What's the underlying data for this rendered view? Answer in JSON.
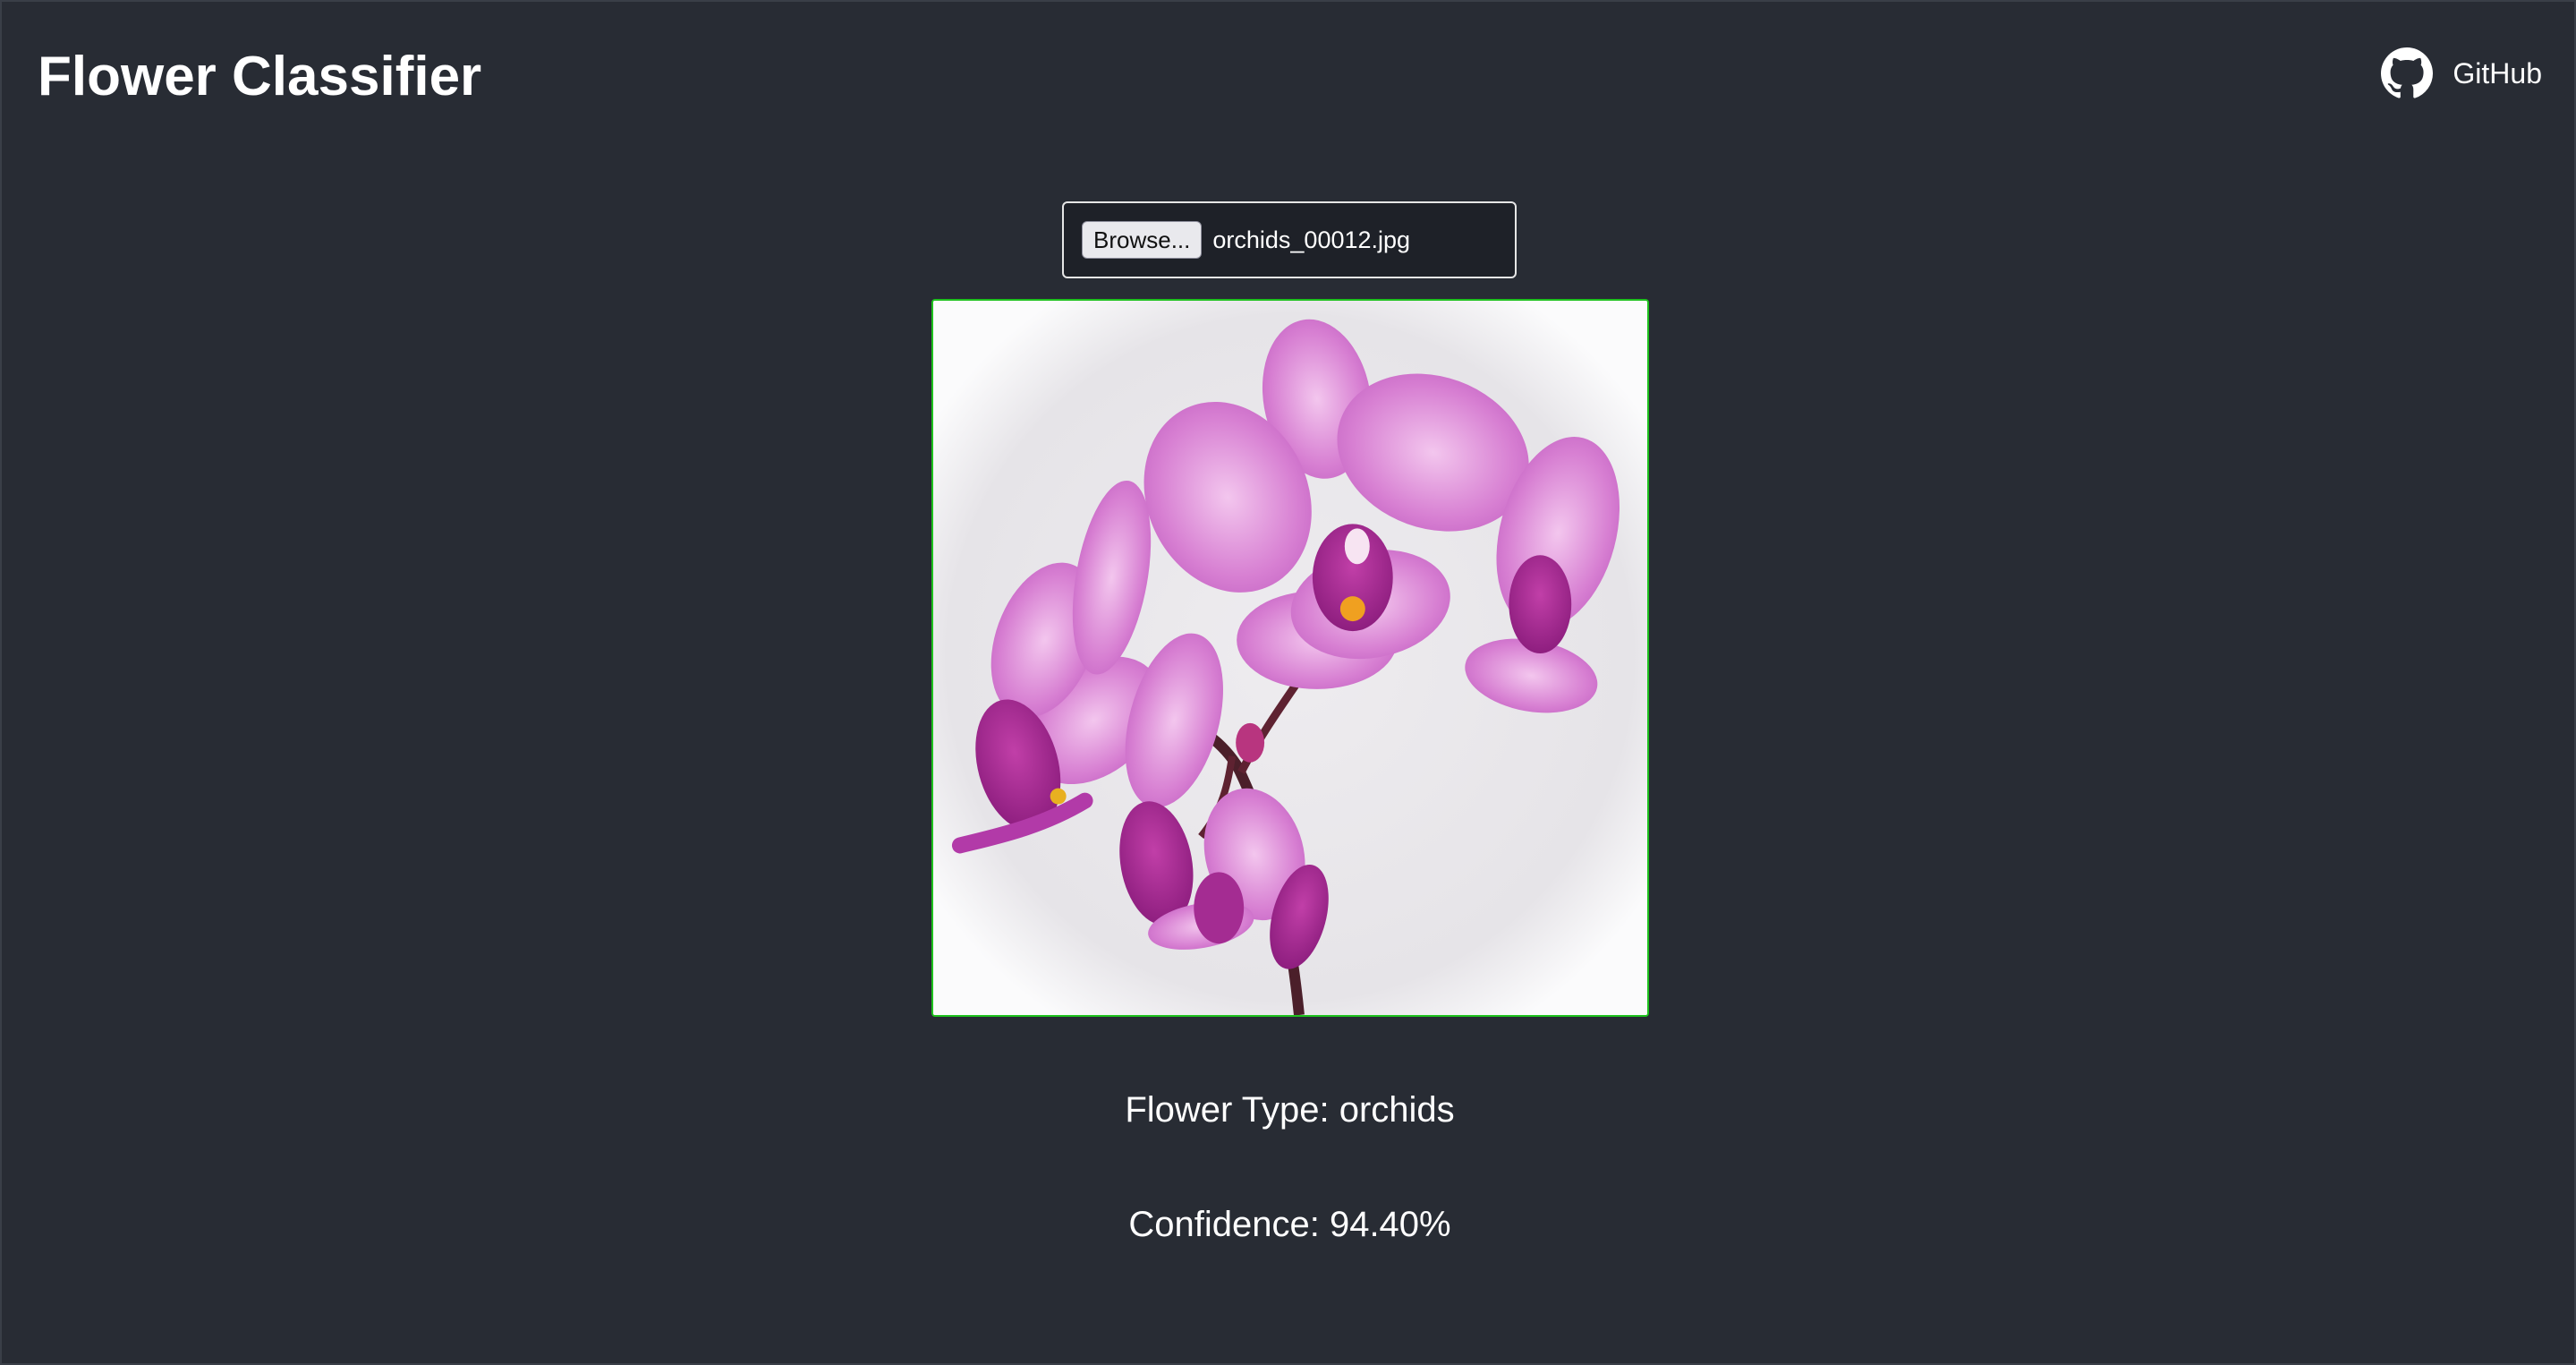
{
  "header": {
    "title": "Flower Classifier",
    "github_label": "GitHub",
    "github_icon": "github-icon"
  },
  "upload": {
    "browse_label": "Browse...",
    "file_name": "orchids_00012.jpg"
  },
  "preview": {
    "image_subject": "pink orchid flower",
    "border_color": "#1ec21e"
  },
  "result": {
    "flower_type_text": "Flower Type: orchids",
    "confidence_text": "Confidence: 94.40%"
  },
  "colors": {
    "background": "#282c34",
    "text": "#ffffff"
  }
}
